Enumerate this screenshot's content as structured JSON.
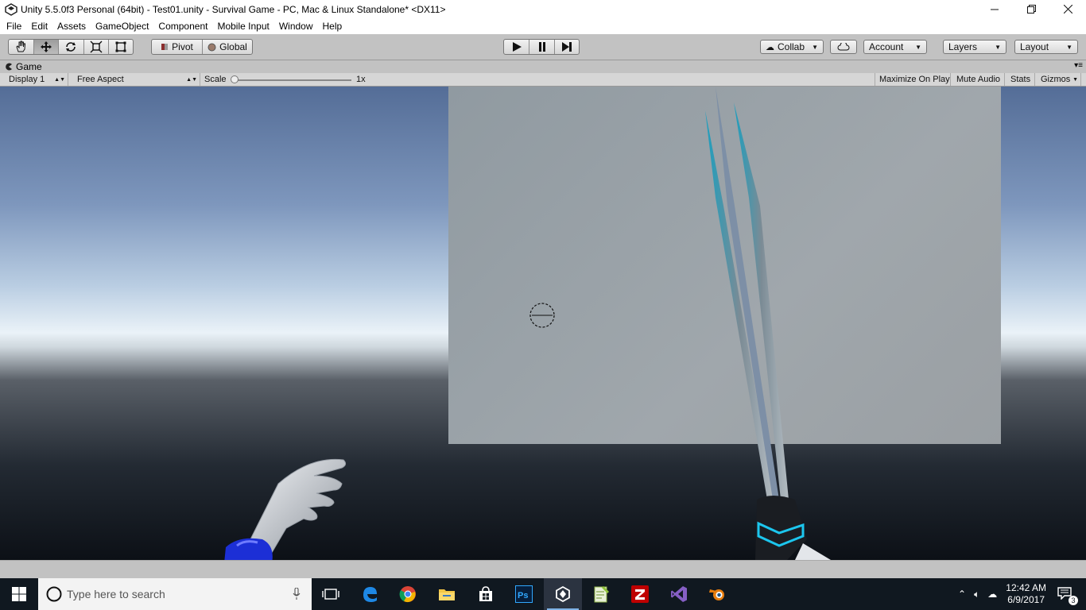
{
  "window": {
    "title": "Unity 5.5.0f3 Personal (64bit) - Test01.unity - Survival Game - PC, Mac & Linux Standalone* <DX11>",
    "controls": [
      "minimize",
      "restore",
      "close"
    ]
  },
  "menubar": {
    "items": [
      "File",
      "Edit",
      "Assets",
      "GameObject",
      "Component",
      "Mobile Input",
      "Window",
      "Help"
    ]
  },
  "toolbar": {
    "pivot_label": "Pivot",
    "global_label": "Global",
    "collab_label": "Collab",
    "account_label": "Account",
    "layers_label": "Layers",
    "layout_label": "Layout"
  },
  "game_tab": {
    "label": "Game",
    "display_value": "Display 1",
    "aspect_value": "Free Aspect",
    "scale_label": "Scale",
    "scale_value": "1x",
    "maximize_label": "Maximize On Play",
    "mute_label": "Mute Audio",
    "stats_label": "Stats",
    "gizmos_label": "Gizmos"
  },
  "taskbar": {
    "search_placeholder": "Type here to search",
    "time": "12:42 AM",
    "date": "6/9/2017",
    "notification_count": "3",
    "apps": [
      "task-view",
      "edge",
      "chrome",
      "file-explorer",
      "store",
      "photoshop",
      "unity",
      "notepad-plus-plus",
      "filezilla",
      "visual-studio",
      "blender"
    ]
  },
  "colors": {
    "editor_gray": "#c2c2c2",
    "taskbar": "#101820",
    "accent": "#7fb2e5"
  }
}
